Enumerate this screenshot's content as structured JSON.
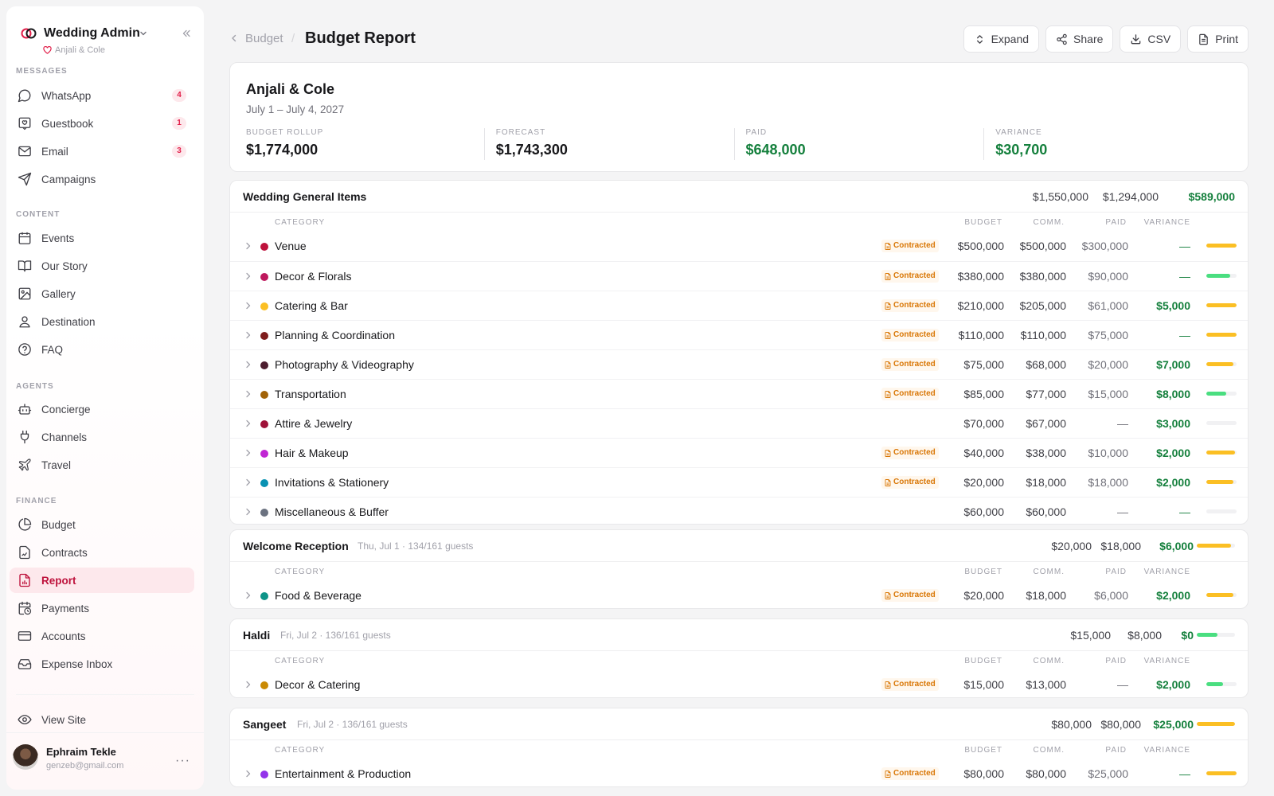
{
  "app": {
    "title": "Wedding Admin",
    "couple": "Anjali & Cole",
    "brand_color": "#e11d48"
  },
  "sidebar": {
    "sections": [
      {
        "label": "MESSAGES",
        "items": [
          {
            "label": "WhatsApp",
            "icon": "message-circle-icon",
            "badge": "4"
          },
          {
            "label": "Guestbook",
            "icon": "guestbook-icon",
            "badge": "1"
          },
          {
            "label": "Email",
            "icon": "mail-icon",
            "badge": "3"
          },
          {
            "label": "Campaigns",
            "icon": "send-icon"
          }
        ]
      },
      {
        "label": "CONTENT",
        "items": [
          {
            "label": "Events",
            "icon": "calendar-icon"
          },
          {
            "label": "Our Story",
            "icon": "book-icon"
          },
          {
            "label": "Gallery",
            "icon": "image-icon"
          },
          {
            "label": "Destination",
            "icon": "map-pin-icon"
          },
          {
            "label": "FAQ",
            "icon": "help-circle-icon"
          }
        ]
      },
      {
        "label": "AGENTS",
        "items": [
          {
            "label": "Concierge",
            "icon": "bot-icon"
          },
          {
            "label": "Channels",
            "icon": "plug-icon"
          },
          {
            "label": "Travel",
            "icon": "plane-icon"
          }
        ]
      },
      {
        "label": "FINANCE",
        "items": [
          {
            "label": "Budget",
            "icon": "pie-chart-icon"
          },
          {
            "label": "Contracts",
            "icon": "file-signature-icon"
          },
          {
            "label": "Report",
            "icon": "file-chart-icon",
            "active": true
          },
          {
            "label": "Payments",
            "icon": "calendar-clock-icon"
          },
          {
            "label": "Accounts",
            "icon": "credit-card-icon"
          },
          {
            "label": "Expense Inbox",
            "icon": "inbox-icon"
          }
        ]
      }
    ],
    "view_site": "View Site",
    "user": {
      "name": "Ephraim Tekle",
      "email": "genzeb@gmail.com",
      "more": "···"
    }
  },
  "header": {
    "breadcrumb_parent": "Budget",
    "breadcrumb_sep": "/",
    "title": "Budget Report",
    "actions": [
      {
        "label": "Expand",
        "icon": "expand-icon"
      },
      {
        "label": "Share",
        "icon": "share-icon"
      },
      {
        "label": "CSV",
        "icon": "download-icon"
      },
      {
        "label": "Print",
        "icon": "print-icon"
      }
    ]
  },
  "summary": {
    "couple": "Anjali & Cole",
    "dates": "July 1 – July 4, 2027",
    "stats": [
      {
        "label": "BUDGET ROLLUP",
        "value": "$1,774,000",
        "tone": "default"
      },
      {
        "label": "FORECAST",
        "value": "$1,743,300",
        "tone": "default"
      },
      {
        "label": "PAID",
        "value": "$648,000",
        "tone": "green"
      },
      {
        "label": "VARIANCE",
        "value": "$30,700",
        "tone": "green"
      }
    ]
  },
  "columns": {
    "category": "CATEGORY",
    "budget": "BUDGET",
    "comm": "COMM.",
    "paid": "PAID",
    "variance": "VARIANCE"
  },
  "status_tag": "Contracted",
  "colors": {
    "yellow": "#fbbf24",
    "green": "#4ade80",
    "green_text": "#15803d",
    "tag_bg": "#fff7ed",
    "tag_text": "#d97706"
  },
  "groups": [
    {
      "title": "Wedding General Items",
      "meta": "",
      "totals": [
        "$1,550,000",
        "$1,294,000",
        "$589,000"
      ],
      "show_bar": false,
      "rows": [
        {
          "name": "Venue",
          "color": "#be123c",
          "contracted": true,
          "budget": "$500,000",
          "comm": "$500,000",
          "paid": "$300,000",
          "variance": "—",
          "progress": 1.0,
          "bar_color": "yellow"
        },
        {
          "name": "Decor & Florals",
          "color": "#be185d",
          "contracted": true,
          "budget": "$380,000",
          "comm": "$380,000",
          "paid": "$90,000",
          "variance": "—",
          "progress": 0.8,
          "bar_color": "green"
        },
        {
          "name": "Catering & Bar",
          "color": "#fbbf24",
          "contracted": true,
          "budget": "$210,000",
          "comm": "$205,000",
          "paid": "$61,000",
          "variance": "$5,000",
          "progress": 1.0,
          "bar_color": "yellow"
        },
        {
          "name": "Planning & Coordination",
          "color": "#7f1d1d",
          "contracted": true,
          "budget": "$110,000",
          "comm": "$110,000",
          "paid": "$75,000",
          "variance": "—",
          "progress": 1.0,
          "bar_color": "yellow"
        },
        {
          "name": "Photography & Videography",
          "color": "#4c1d2e",
          "contracted": true,
          "budget": "$75,000",
          "comm": "$68,000",
          "paid": "$20,000",
          "variance": "$7,000",
          "progress": 0.9,
          "bar_color": "yellow"
        },
        {
          "name": "Transportation",
          "color": "#a16207",
          "contracted": true,
          "budget": "$85,000",
          "comm": "$77,000",
          "paid": "$15,000",
          "variance": "$8,000",
          "progress": 0.65,
          "bar_color": "green"
        },
        {
          "name": "Attire & Jewelry",
          "color": "#9f1239",
          "contracted": false,
          "budget": "$70,000",
          "comm": "$67,000",
          "paid": "—",
          "variance": "$3,000",
          "progress": 0,
          "bar_color": "yellow"
        },
        {
          "name": "Hair & Makeup",
          "color": "#c026d3",
          "contracted": true,
          "budget": "$40,000",
          "comm": "$38,000",
          "paid": "$10,000",
          "variance": "$2,000",
          "progress": 0.95,
          "bar_color": "yellow"
        },
        {
          "name": "Invitations & Stationery",
          "color": "#0891b2",
          "contracted": true,
          "budget": "$20,000",
          "comm": "$18,000",
          "paid": "$18,000",
          "variance": "$2,000",
          "progress": 0.9,
          "bar_color": "yellow"
        },
        {
          "name": "Miscellaneous & Buffer",
          "color": "#6b7280",
          "contracted": false,
          "budget": "$60,000",
          "comm": "$60,000",
          "paid": "—",
          "variance": "—",
          "progress": 0,
          "bar_color": "yellow"
        }
      ]
    },
    {
      "title": "Welcome Reception",
      "meta": "Thu, Jul 1 · 134/161 guests",
      "totals": [
        "$20,000",
        "$18,000",
        "$6,000"
      ],
      "show_bar": true,
      "progress": 0.9,
      "bar_color": "yellow",
      "rows": [
        {
          "name": "Food & Beverage",
          "color": "#0d9488",
          "contracted": true,
          "budget": "$20,000",
          "comm": "$18,000",
          "paid": "$6,000",
          "variance": "$2,000",
          "progress": 0.9,
          "bar_color": "yellow"
        }
      ]
    },
    {
      "title": "Haldi",
      "meta": "Fri, Jul 2 · 136/161 guests",
      "totals": [
        "$15,000",
        "$8,000",
        "$0"
      ],
      "show_bar": true,
      "progress": 0.55,
      "bar_color": "green",
      "rows": [
        {
          "name": "Decor & Catering",
          "color": "#ca8a04",
          "contracted": true,
          "budget": "$15,000",
          "comm": "$13,000",
          "paid": "—",
          "variance": "$2,000",
          "progress": 0.55,
          "bar_color": "green"
        }
      ]
    },
    {
      "title": "Sangeet",
      "meta": "Fri, Jul 2 · 136/161 guests",
      "totals": [
        "$80,000",
        "$80,000",
        "$25,000"
      ],
      "show_bar": true,
      "progress": 1.0,
      "bar_color": "yellow",
      "rows": [
        {
          "name": "Entertainment & Production",
          "color": "#9333ea",
          "contracted": true,
          "budget": "$80,000",
          "comm": "$80,000",
          "paid": "$25,000",
          "variance": "—",
          "progress": 1.0,
          "bar_color": "yellow"
        }
      ]
    }
  ]
}
